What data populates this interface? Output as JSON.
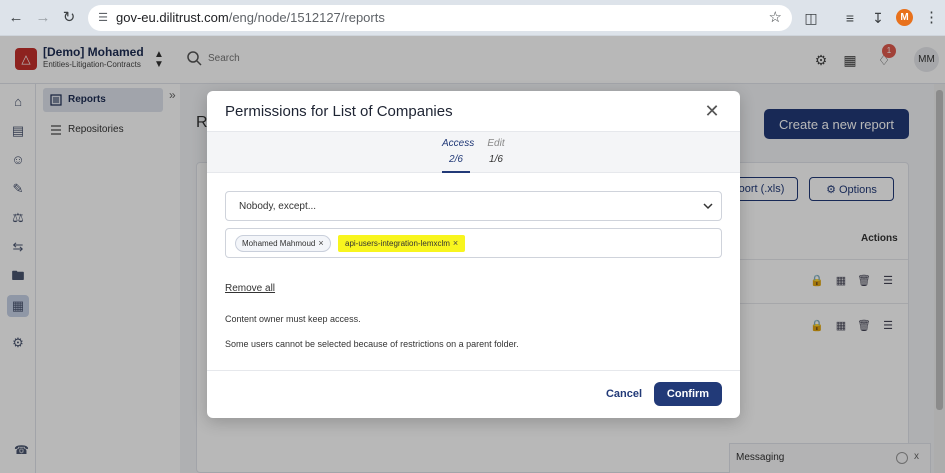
{
  "browser": {
    "url_host": "gov-eu.dilitrust.com",
    "url_path": "/eng/node/1512127/reports",
    "profile_initial": "M"
  },
  "header": {
    "org_name": "[Demo] Mohamed",
    "org_sub": "Entities-Litigation-Contracts",
    "search_placeholder": "Search",
    "notif_count": "1",
    "user_initials": "MM"
  },
  "sidebar": {
    "items": [
      {
        "label": "Reports"
      },
      {
        "label": "Repositories"
      }
    ]
  },
  "main": {
    "page_title_fragment": "R",
    "create_button": "Create a new report",
    "export_button": "oort (.xls)",
    "options_button": "Options",
    "actions_header": "Actions",
    "messaging_label": "Messaging",
    "messaging_close": "x"
  },
  "modal": {
    "title": "Permissions for List of Companies",
    "tabs": [
      {
        "label": "Access",
        "count": "2/6"
      },
      {
        "label": "Edit",
        "count": "1/6"
      }
    ],
    "select_value": "Nobody, except...",
    "tags": [
      {
        "label": "Mohamed Mahmoud"
      },
      {
        "label": "api-users-integration-lemxclm"
      }
    ],
    "remove_all": "Remove all",
    "note_owner": "Content owner must keep access.",
    "note_restrictions": "Some users cannot be selected because of restrictions on a parent folder.",
    "cancel": "Cancel",
    "confirm": "Confirm"
  },
  "colors": {
    "brand": "#223a78",
    "highlight": "#f8f51e",
    "logo": "#c4302b"
  }
}
